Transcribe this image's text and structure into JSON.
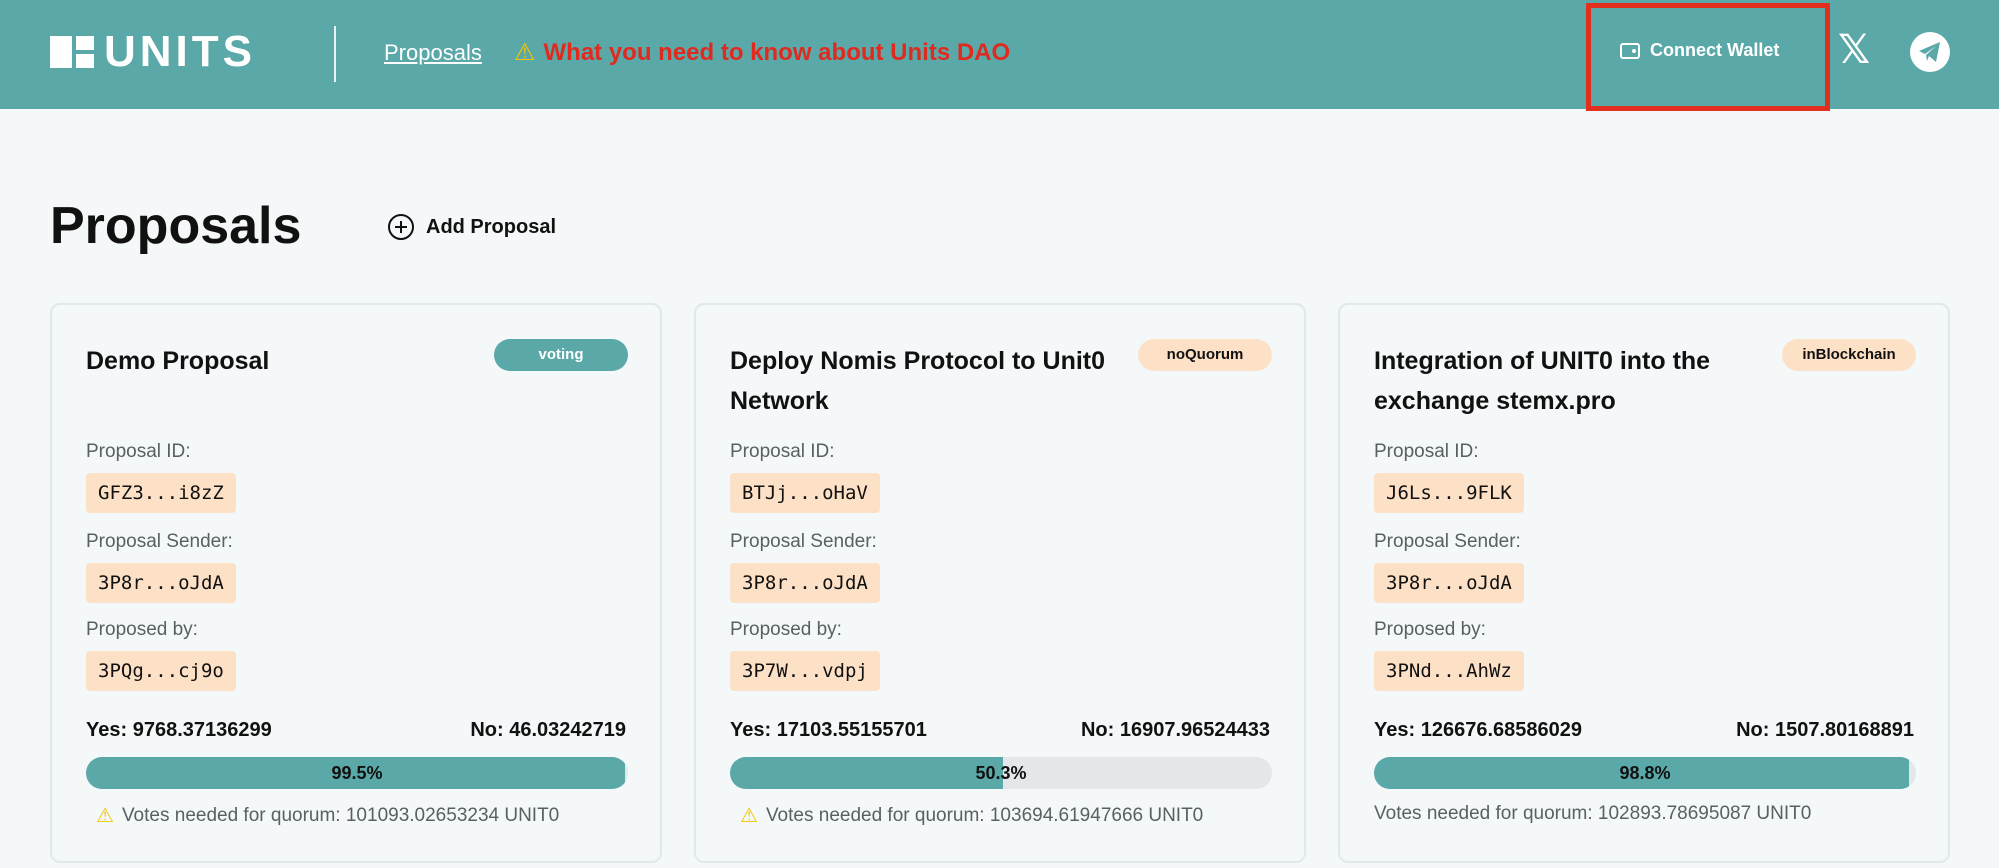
{
  "header": {
    "logo_text": "UNITS",
    "nav_proposals": "Proposals",
    "notice_icon": "warning-icon",
    "notice_text": "What you need to know about Units DAO",
    "connect_wallet": "Connect Wallet",
    "social": [
      "x-icon",
      "telegram-icon"
    ]
  },
  "page": {
    "title": "Proposals",
    "add_proposal": "Add Proposal"
  },
  "labels": {
    "proposal_id": "Proposal ID:",
    "proposal_sender": "Proposal Sender:",
    "proposed_by": "Proposed by:"
  },
  "cards": [
    {
      "title": "Demo Proposal",
      "status": "voting",
      "proposal_id": "GFZ3...i8zZ",
      "sender": "3P8r...oJdA",
      "proposed_by": "3PQg...cj9o",
      "yes": "Yes: 9768.37136299",
      "no": "No: 46.03242719",
      "percent": "99.5%",
      "percent_value": 99.5,
      "quorum_warning": true,
      "quorum": "Votes needed for quorum: 101093.02653234 UNIT0"
    },
    {
      "title": "Deploy Nomis Protocol to Unit0 Network",
      "status": "noQuorum",
      "proposal_id": "BTJj...oHaV",
      "sender": "3P8r...oJdA",
      "proposed_by": "3P7W...vdpj",
      "yes": "Yes: 17103.55155701",
      "no": "No: 16907.96524433",
      "percent": "50.3%",
      "percent_value": 50.3,
      "quorum_warning": true,
      "quorum": "Votes needed for quorum: 103694.61947666 UNIT0"
    },
    {
      "title": "Integration of UNIT0 into the exchange stemx.pro",
      "status": "inBlockchain",
      "proposal_id": "J6Ls...9FLK",
      "sender": "3P8r...oJdA",
      "proposed_by": "3PNd...AhWz",
      "yes": "Yes: 126676.68586029",
      "no": "No: 1507.80168891",
      "percent": "98.8%",
      "percent_value": 98.8,
      "quorum_warning": false,
      "quorum": "Votes needed for quorum: 102893.78695087 UNIT0"
    }
  ],
  "colors": {
    "header_bg": "#5ba8a8",
    "accent": "#5ba8a8",
    "notice": "#e02a1f",
    "chip_bg": "#fde1c7",
    "highlight": "#e3301e"
  }
}
